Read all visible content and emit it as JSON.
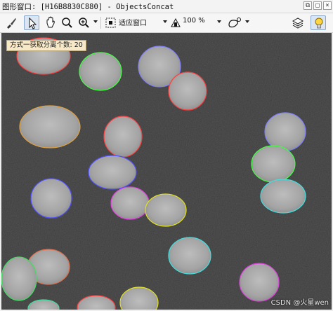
{
  "window": {
    "title": "图形窗口: [H16B8830C880] - ObjectsConcat"
  },
  "toolbar": {
    "zoom_mode_label": "适应窗口",
    "zoom_percent_label": "100 %",
    "tools": [
      {
        "name": "brush-icon"
      },
      {
        "name": "pointer-icon",
        "active": true
      },
      {
        "name": "hand-icon"
      },
      {
        "name": "magnify-icon"
      },
      {
        "name": "zoom-in-icon"
      },
      {
        "name": "fit-window-icon"
      },
      {
        "name": "zoom-percent-icon"
      },
      {
        "name": "region-draw-icon"
      },
      {
        "name": "layers-icon"
      },
      {
        "name": "lightbulb-icon"
      }
    ]
  },
  "tooltip": {
    "text": "方式一获取分离个数: 20"
  },
  "watermark": {
    "text": "CSDN @火星wen"
  },
  "image": {
    "object_count": 20,
    "contour_colors": [
      "#ff4040",
      "#40ff40",
      "#5050ff",
      "#40e0e0",
      "#e040e0",
      "#e0e020",
      "#e0a040",
      "#8080ff"
    ]
  }
}
